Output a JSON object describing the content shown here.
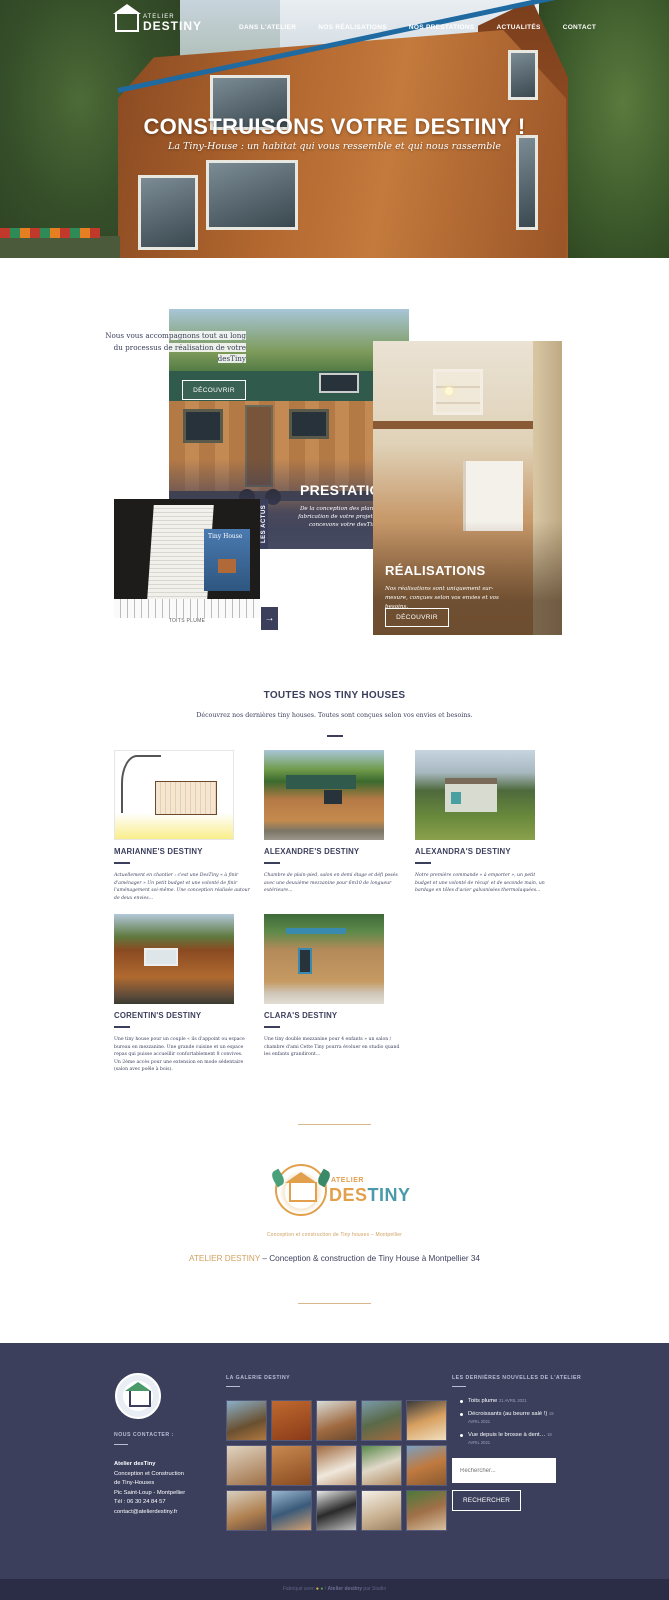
{
  "header": {
    "logo": {
      "small": "ATELIER",
      "big": "DESTINY"
    },
    "nav": [
      {
        "label": "DANS L'ATELIER"
      },
      {
        "label": "NOS RÉALISATIONS"
      },
      {
        "label": "NOS PRESTATIONS"
      },
      {
        "label": "ACTUALITÉS"
      },
      {
        "label": "CONTACT"
      }
    ],
    "title": "CONSTRUISONS VOTRE DESTINY !",
    "tagline": "La Tiny-House : un habitat qui vous ressemble et qui nous rassemble"
  },
  "services": {
    "intro": "Nous vous accompagnons tout au long du processus de réalisation de votre desTiny",
    "decouvrir_1": "DÉCOUVRIR",
    "prestations": {
      "title": "PRESTATIONS",
      "text": "De la conception des plans à la fabrication de votre projet, nous concevons votre desTiny"
    },
    "realisations": {
      "title": "RÉALISATIONS",
      "text": "Nos réalisations sont uniquement sur-mesure, conçues selon vos envies et vos besoins.",
      "button": "DÉCOUVRIR"
    },
    "actus": {
      "label": "LES ACTUS",
      "caption": "TOITS PLUME",
      "cover_text": "Tiny House",
      "arrow": "→"
    }
  },
  "tiny_houses": {
    "title": "TOUTES NOS TINY HOUSES",
    "subtitle": "Découvrez nos dernières tiny houses. Toutes sont conçues selon vos envies et besoins.",
    "items": [
      {
        "name": "MARIANNE'S DESTINY",
        "desc": "Actuellement en chantier : c'est une DesTiny « à finir d'aménager » Un petit budget et une volonté de finir l'aménagement soi-même. Une conception réalisée autour de deux envies..."
      },
      {
        "name": "ALEXANDRE'S DESTINY",
        "desc": "Chambre de plain-pied, salon en demi étage et défi posés avec une deuxième mezzanine pour 6m10 de longueur extérieure..."
      },
      {
        "name": "ALEXANDRA'S DESTINY",
        "desc": "Notre première commande « à emporter », un petit budget et une volonté de récup' et de seconde main, un bardage en tôles d'acier galvanisées thermolaquées..."
      },
      {
        "name": "CORENTIN'S DESTINY",
        "desc": "Une tiny house pour un couple « ils d'appoint ou espace bureau en mezzanine. Une grande cuisine et un espace repas qui puisse accueillir confortablement 8 convives. Un 2ème accès pour une extension en mode sédentaire (salon avec poêle à bois)."
      },
      {
        "name": "CLARA'S DESTINY",
        "desc": "Une tiny double mezzanine pour 4 enfants » un salon / chambre d'ami Cette Tiny pourra évoluer en studio quand les enfants grandiront..."
      }
    ]
  },
  "brand": {
    "logo_word1": "ATELIER",
    "logo_word2a": "DES",
    "logo_word2b": "TINY",
    "small": "Conception et construction de Tiny houses – Montpellier",
    "line_highlight": "ATELIER DESTINY",
    "line_rest": " – Conception & construction de Tiny House à Montpellier 34"
  },
  "footer": {
    "contact_heading": "NOUS CONTACTER :",
    "contact": {
      "name": "Atelier desTiny",
      "line1": "Conception et Construction",
      "line2": "de Tiny-Houses",
      "line3": "Pic Saint-Loup - Montpellier",
      "phone": "Tél : 06 30 24 84 57",
      "email": "contact@atelierdestiny.fr"
    },
    "gallery_heading": "LA GALERIE DESTINY",
    "news_heading": "LES DERNIÈRES NOUVELLES DE L'ATELIER",
    "news": [
      {
        "title": "Toits plume",
        "date": "21 AVRIL 2021"
      },
      {
        "title": "Décroissants (au beurre salé !)",
        "date": "19 AVRIL 2021"
      },
      {
        "title": "Vue depuis le brosse à dent…",
        "date": "19 AVRIL 2021"
      }
    ],
    "search_placeholder": "Rechercher...",
    "search_button": "RECHERCHER"
  },
  "bottom_bar": {
    "prefix": "Fabriqué avec",
    "sep": "/",
    "brand": "Atelier destiny",
    "by": "par",
    "author": "Studio"
  },
  "colors": {
    "primary": "#3b3f5c",
    "accent": "#d0a060",
    "teal": "#4a9aaa"
  }
}
